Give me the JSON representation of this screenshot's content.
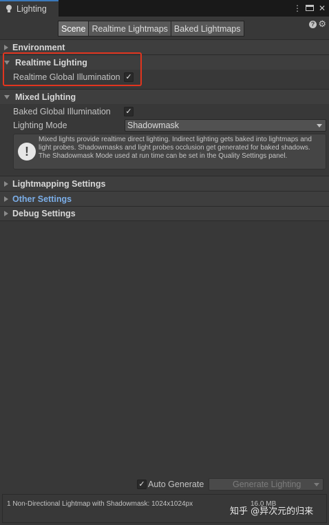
{
  "window": {
    "tab_title": "Lighting",
    "icons": [
      "lightbulb-icon",
      "more-icon",
      "maximize-icon",
      "close-icon"
    ]
  },
  "toolbar": {
    "tabs": [
      {
        "label": "Scene",
        "active": true
      },
      {
        "label": "Realtime Lightmaps",
        "active": false
      },
      {
        "label": "Baked Lightmaps",
        "active": false
      }
    ],
    "icons": [
      "help-icon",
      "gear-icon"
    ]
  },
  "sections": {
    "environment": {
      "label": "Environment",
      "expanded": false
    },
    "realtime_lighting": {
      "label": "Realtime Lighting",
      "expanded": true,
      "realtime_gi_label": "Realtime Global Illumination",
      "realtime_gi_checked": true
    },
    "mixed_lighting": {
      "label": "Mixed Lighting",
      "expanded": true,
      "baked_gi_label": "Baked Global Illumination",
      "baked_gi_checked": true,
      "lighting_mode_label": "Lighting Mode",
      "lighting_mode_value": "Shadowmask",
      "help_text": "Mixed lights provide realtime direct lighting. Indirect lighting gets baked into lightmaps and light probes. Shadowmasks and light probes occlusion get generated for baked shadows. The Shadowmask Mode used at run time can be set in the Quality Settings panel."
    },
    "lightmapping_settings": {
      "label": "Lightmapping Settings",
      "expanded": false
    },
    "other_settings": {
      "label": "Other Settings",
      "expanded": false
    },
    "debug_settings": {
      "label": "Debug Settings",
      "expanded": false
    }
  },
  "footer": {
    "auto_generate_label": "Auto Generate",
    "auto_generate_checked": true,
    "generate_button_label": "Generate Lighting",
    "status_text": "1 Non-Directional Lightmap with Shadowmask: 1024x1024px",
    "status_size": "16.0 MB",
    "watermark": "知乎 @异次元的归来"
  },
  "colors": {
    "accent_tab": "#3a79bb",
    "highlight_box": "#e2341e",
    "other_settings_label": "#7baee8"
  }
}
